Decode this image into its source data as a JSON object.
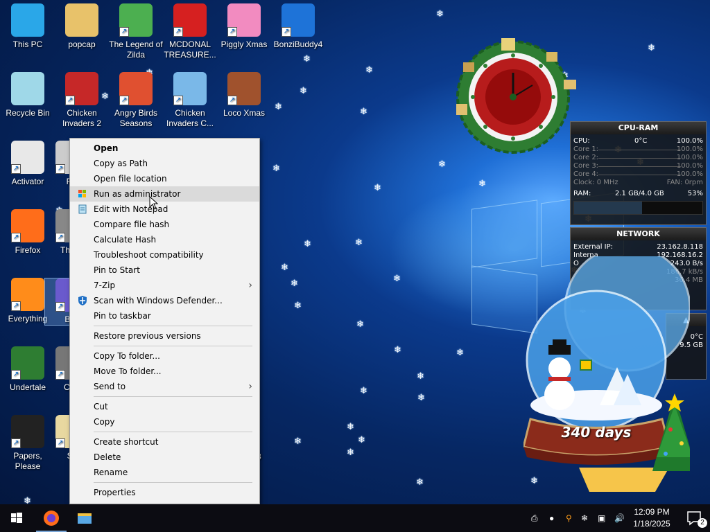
{
  "desktop": {
    "icons": [
      {
        "label": "This PC",
        "icon": "computer-icon",
        "color": "#2aa7e8"
      },
      {
        "label": "popcap",
        "icon": "folder-icon",
        "color": "#e8c26a"
      },
      {
        "label": "The Legend of Zilda",
        "icon": "game-icon",
        "color": "#4caf50"
      },
      {
        "label": "MCDONAL TREASURE...",
        "icon": "game-icon",
        "color": "#d62020"
      },
      {
        "label": "Piggly Xmas",
        "icon": "game-icon",
        "color": "#f28bc0"
      },
      {
        "label": "BonziBuddy4",
        "icon": "window-icon",
        "color": "#1e73d8"
      },
      {
        "label": "Recycle Bin",
        "icon": "recycle-bin-icon",
        "color": "#9fd8e8"
      },
      {
        "label": "Chicken Invaders 2",
        "icon": "game-icon",
        "color": "#c62828"
      },
      {
        "label": "Angry Birds Seasons",
        "icon": "game-icon",
        "color": "#e05030"
      },
      {
        "label": "Chicken Invaders C...",
        "icon": "game-icon",
        "color": "#7ab8e8"
      },
      {
        "label": "Loco Xmas",
        "icon": "game-icon",
        "color": "#a0522d"
      },
      {
        "label": "Activator",
        "icon": "file-icon",
        "color": "#e8e8e8"
      },
      {
        "label": "Fla",
        "icon": "file-icon",
        "color": "#cccccc"
      },
      {
        "label": "Firefox",
        "icon": "firefox-icon",
        "color": "#ff6d1a"
      },
      {
        "label": "Th Ma",
        "icon": "game-icon",
        "color": "#888888"
      },
      {
        "label": "Everything",
        "icon": "search-icon",
        "color": "#ff8c1a"
      },
      {
        "label": "Bon",
        "icon": "game-icon",
        "color": "#6a5acd"
      },
      {
        "label": "Undertale",
        "icon": "game-icon",
        "color": "#2e7d32"
      },
      {
        "label": "C Br",
        "icon": "game-icon",
        "color": "#777777"
      },
      {
        "label": "Papers, Please",
        "icon": "game-icon",
        "color": "#222222"
      },
      {
        "label": "Su",
        "icon": "file-icon",
        "color": "#e8d8a0"
      }
    ],
    "partial_labels": [
      ".",
      "3"
    ]
  },
  "context_menu": {
    "items": [
      {
        "label": "Open",
        "bold": true
      },
      {
        "label": "Copy as Path"
      },
      {
        "label": "Open file location"
      },
      {
        "label": "Run as administrator",
        "icon": "shield-uac-icon",
        "highlighted": true
      },
      {
        "label": "Edit with Notepad",
        "icon": "notepad-icon"
      },
      {
        "label": "Compare file hash"
      },
      {
        "label": "Calculate Hash"
      },
      {
        "label": "Troubleshoot compatibility"
      },
      {
        "label": "Pin to Start"
      },
      {
        "label": "7-Zip",
        "submenu": true
      },
      {
        "label": "Scan with Windows Defender...",
        "icon": "defender-icon"
      },
      {
        "label": "Pin to taskbar"
      },
      {
        "separator": true
      },
      {
        "label": "Restore previous versions"
      },
      {
        "separator": true
      },
      {
        "label": "Copy To folder..."
      },
      {
        "label": "Move To folder..."
      },
      {
        "label": "Send to",
        "submenu": true
      },
      {
        "separator": true
      },
      {
        "label": "Cut"
      },
      {
        "label": "Copy"
      },
      {
        "separator": true
      },
      {
        "label": "Create shortcut"
      },
      {
        "label": "Delete"
      },
      {
        "label": "Rename"
      },
      {
        "separator": true
      },
      {
        "label": "Properties"
      }
    ],
    "submenu_arrow": "›"
  },
  "cpu_ram": {
    "title": "CPU-RAM",
    "cpu_label": "CPU:",
    "cpu_temp": "0°C",
    "cpu_pct": "100.0%",
    "cores": [
      {
        "label": "Core 1:",
        "value": "100.0%"
      },
      {
        "label": "Core 2:",
        "value": "100.0%"
      },
      {
        "label": "Core 3:",
        "value": "100.0%"
      },
      {
        "label": "Core 4:",
        "value": "100.0%"
      }
    ],
    "clock": "Clock: 0 MHz",
    "fan": "FAN: 0rpm",
    "ram_label": "RAM:",
    "ram_used": "2.1 GB/4.0 GB",
    "ram_pct": "53%",
    "ram_fraction": 0.53
  },
  "network": {
    "title": "NETWORK",
    "external_label": "External IP:",
    "external_ip": "23.162.8.118",
    "internal_label": "Interna",
    "internal_ip": "192.168.16.2",
    "row3_label": "O",
    "rate1": "243.0 B/s",
    "rate2": "186.7 kB/s",
    "rate3": "36.4 MB"
  },
  "disk_gadget": {
    "temp": "0°C",
    "size": "9.5 GB"
  },
  "snow_globe": {
    "countdown": "340 days"
  },
  "taskbar": {
    "start_icon": "windows-start-icon",
    "pinned": [
      "firefox-icon",
      "file-explorer-icon"
    ],
    "tray_icons": [
      "printer-icon",
      "drop-icon",
      "search-icon",
      "snowflake-icon",
      "network-icon",
      "volume-icon"
    ],
    "time": "12:09 PM",
    "date": "1/18/2025",
    "notification_count": "2"
  }
}
